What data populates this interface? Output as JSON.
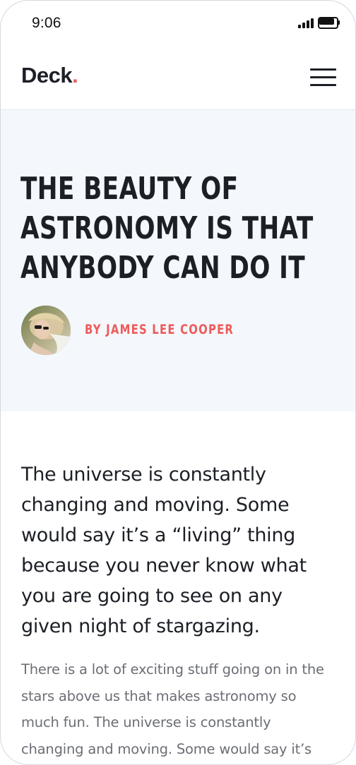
{
  "status_bar": {
    "time": "9:06",
    "icons": [
      "cellular-signal-icon",
      "battery-icon"
    ]
  },
  "navbar": {
    "logo_text": "Deck",
    "logo_dot": ".",
    "menu_icon": "hamburger-menu-icon"
  },
  "hero": {
    "headline": "THE BEAUTY OF ASTRONOMY IS THAT ANYBODY CAN DO IT",
    "byline": "BY JAMES LEE COOPER",
    "avatar_alt": "author-avatar"
  },
  "article": {
    "lead": "The universe is constantly changing and moving. Some would say it’s a “living” thing because you never know what you are going to see on any given night of stargazing.",
    "body": "There is a lot of exciting stuff going on in the stars above us that makes astronomy so much fun. The universe is constantly changing and moving. Some would say it’s"
  },
  "colors": {
    "accent": "#ee5a5a",
    "text_dark": "#1c1f26",
    "text_muted": "#6b6e75",
    "hero_bg": "#f4f7fb",
    "divider": "#e4e7ec"
  }
}
